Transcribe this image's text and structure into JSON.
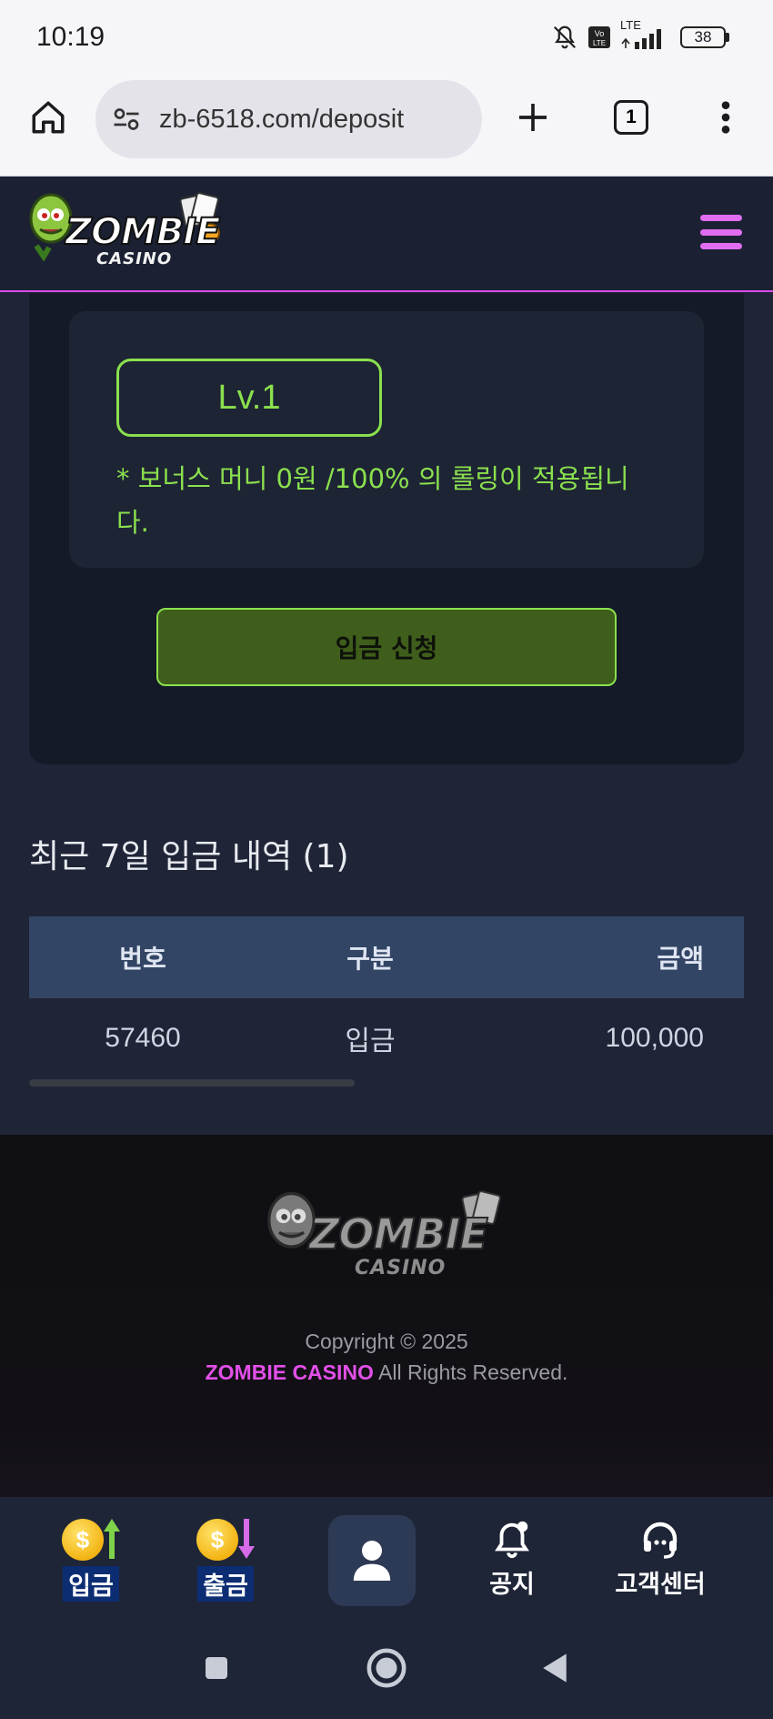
{
  "status_bar": {
    "time": "10:19",
    "battery": "38",
    "network": "LTE",
    "icons": [
      "mute-bell-icon",
      "volte-icon",
      "signal-icon",
      "battery-icon"
    ]
  },
  "browser": {
    "url": "zb-6518.com/deposit",
    "tab_count": "1",
    "icons": [
      "home-icon",
      "site-settings-icon",
      "new-tab-icon",
      "tabs-icon",
      "more-icon"
    ]
  },
  "header": {
    "logo_text": "ZOMBIE",
    "logo_sub": "CASINO",
    "menu_icon": "hamburger-icon",
    "accent": "#e06df0"
  },
  "deposit": {
    "level": "Lv.1",
    "bonus_note": "* 보너스 머니 0원 /100% 의 롤링이 적용됩니다.",
    "submit_label": "입금 신청",
    "accent": "#8be04e"
  },
  "history": {
    "title": "최근 7일 입금 내역 (1)",
    "columns": [
      "번호",
      "구분",
      "금액"
    ],
    "rows": [
      [
        "57460",
        "입금",
        "100,000"
      ]
    ]
  },
  "footer": {
    "logo_text": "ZOMBIE",
    "logo_sub": "CASINO",
    "copyright_line": "Copyright © 2025",
    "brand": "ZOMBIE CASINO",
    "rights": "All Rights Reserved."
  },
  "bottom_nav": {
    "items": [
      {
        "label": "입금",
        "icon": "coin-up-icon"
      },
      {
        "label": "출금",
        "icon": "coin-down-icon"
      },
      {
        "label": "",
        "icon": "user-icon"
      },
      {
        "label": "공지",
        "icon": "bell-icon"
      },
      {
        "label": "고객센터",
        "icon": "headset-icon"
      }
    ]
  },
  "android_nav": {
    "icons": [
      "recents-icon",
      "home-circle-icon",
      "back-icon"
    ]
  }
}
